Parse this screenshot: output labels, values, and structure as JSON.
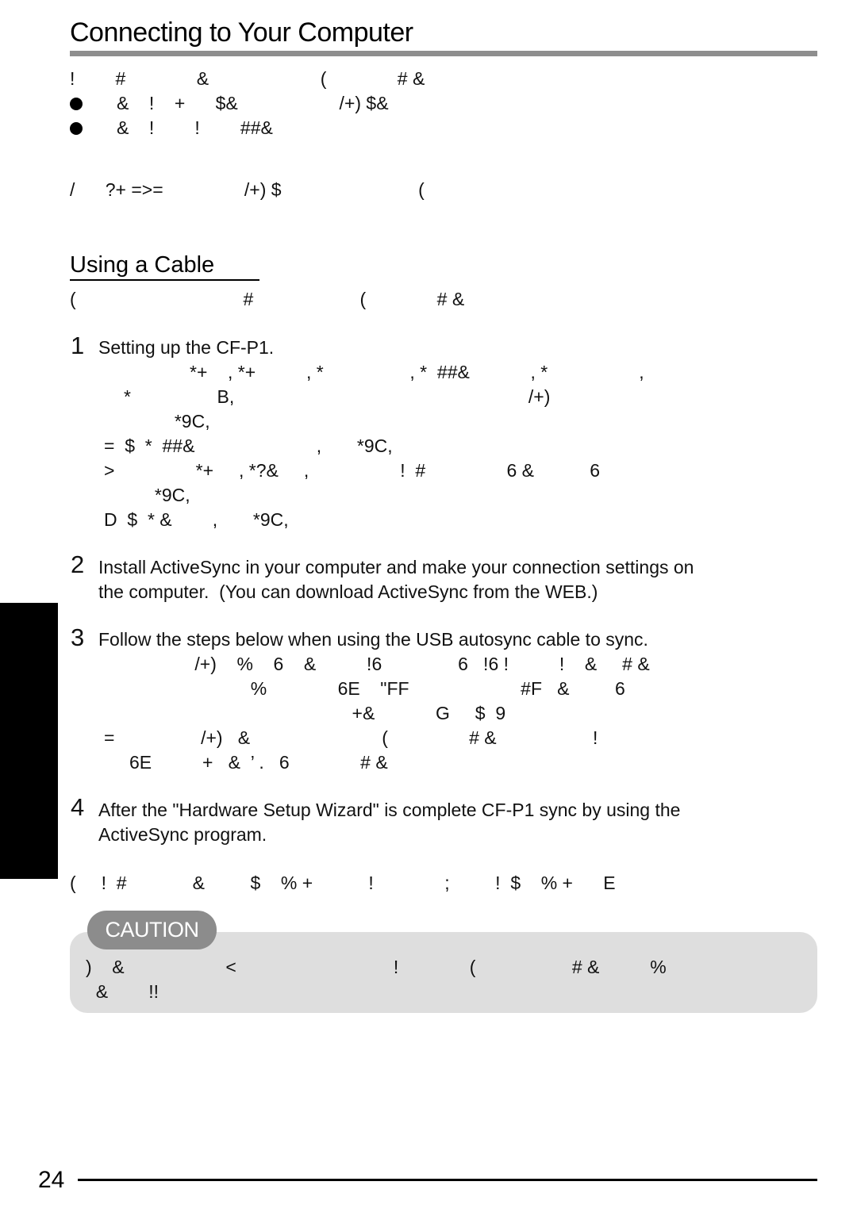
{
  "header": {
    "title": "Connecting to Your Computer"
  },
  "intro": {
    "lines": [
      "!        #              &                      (              # &",
      "&    !    +      $&                    /+) $&",
      "&    !        !        ##&"
    ],
    "bullet_icon": "filled-circle-bullet",
    "note": "/      ?+ =>=                /+) $                           ("
  },
  "section": {
    "heading": "Using a Cable",
    "intro": "(                                 #                     (              # &"
  },
  "steps": [
    {
      "number": "1",
      "title": "Setting up the CF-P1.",
      "sublines": [
        "                  *+    , *+          , *                 , *  ##&            , *                  ,",
        "     *                 B,                                                          /+)",
        "               *9C,",
        "=  $  *  ##&                        ,       *9C,",
        ">                *+     , *?&     ,                  !  #                6 &           6",
        "          *9C,",
        "D  $  * &        ,       *9C,"
      ]
    },
    {
      "number": "2",
      "title": "Install ActiveSync in your computer and make your connection settings on the computer.  (You can download ActiveSync from the WEB.)",
      "title_lines": [
        "Install ActiveSync in your computer and make your connection settings on",
        "the computer.  (You can download ActiveSync from the WEB.)"
      ],
      "sublines": []
    },
    {
      "number": "3",
      "title": "Follow the steps below when using the USB autosync cable to sync.",
      "sublines": [
        "                   /+)    %    6    &          !6               6   !6 !          !    &     # &",
        "                              %              6E    \"FF                      #F   &         6",
        "                                                  +&            G     $  9",
        "=                 /+)   &                          (                # &                   !",
        "     6E          +   &  ’ .   6              # &"
      ]
    },
    {
      "number": "4",
      "title_lines": [
        "After the \"Hardware Setup Wizard\" is complete CF-P1 sync by using the",
        "ActiveSync program."
      ],
      "sublines": []
    }
  ],
  "closing_note": "(     !  #             &         $    % +           !              ;         !  $    % +      E",
  "caution": {
    "badge": "CAUTION",
    "lines": [
      ")    &                    <                               !              (                   # &          %",
      "  &        !!"
    ]
  },
  "footer": {
    "page_number": "24"
  }
}
